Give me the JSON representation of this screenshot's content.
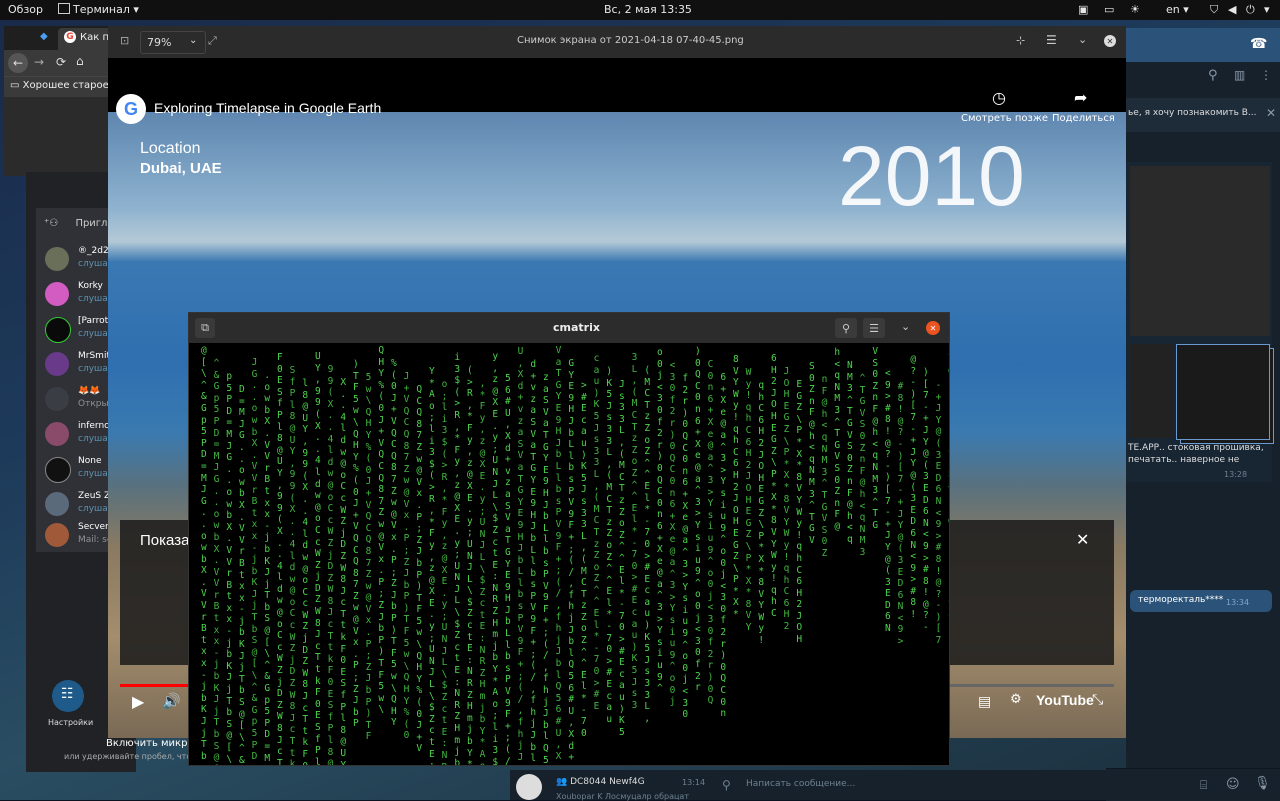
{
  "topbar": {
    "activities": "Обзор",
    "app_menu": "Терминал",
    "datetime": "Вс, 2 мая  13:35",
    "lang": "en"
  },
  "browser": {
    "tab_title": "Как п",
    "bookmark": "Хорошее старое)))"
  },
  "viewer": {
    "zoom": "79%",
    "title": "Снимок экрана от 2021-04-18 07-40-45.png"
  },
  "video": {
    "title": "Exploring Timelapse in Google Earth",
    "watch_later": "Смотреть позже",
    "share": "Поделиться",
    "location_label": "Location",
    "location_value": "Dubai, UAE",
    "year": "2010",
    "overlay_text": "Показа",
    "youtube": "YouTube"
  },
  "terminal": {
    "title": "cmatrix",
    "columns": [
      "     @  [  \\  ^  &  G  p          5  P  D  =  M  J  G  .  .  o  w  b  X  .  V  V  r  B  t  x  x  -  j  b  K  J  j  T  b  S",
      "     F  0  E  S  f  P  l  8  @  U  Y  ,  9  9  (  X  .  .  4  l  d  w  @  o  C  c  W  Z  j  D  Z  W  8  J  c  T  t  k",
      "     )  T  F  5  w  \\  Q  H  Y  %  (  0  J  +  V  Q  C  Q  8  7  Z  w  @  V  x  .  P  ;  Z  J  b  P",
      "     Y  *  A  o  ;  l  i  3  $  (  >  R  ,  *  F  y  ,  z  @  X  E  .  y  ;  U  N  J  L  \\  $  Z  c  t  E  :  N  R  Z  H  m  j  b",
      "     5  6  #  U  ,  X  d  +  v  z  a  S  V  a  T  G  Y  E  9  H  J  b  L  l  b  s  P  V  9  F  +  ;  (  /  ,  f  h  j  J  b  l  Q",
      "     >  #  E  c  a  u  )  K  5  J  s  3  3  L  ,  (  M  C  T  z  Z  o  Z  ^  ^  E  l  *  -  7  0",
      "     o  0  j  <  3  0  f  2  r  )  0  Q  C  0  n  6  +  X  e  @  a  ^  3  >  Y  s  i  u  9  ^",
      "     8  V  Y  W  y  !  q  h  C  6  H  2  J  O  H  E  G  Z  \\  P  *  X  *",
      "     S  0  Z  n  F  @  h  <  q  N  M  3  ^  T  G  V",
      "     <  9  >  #  8  !  @  ?  -  )  [  7  -  +  J  Y  @  (  3  E  D  6  N"
    ]
  },
  "discord": {
    "invite_label": "Пригла",
    "users": [
      {
        "name": "®_2d2",
        "status": "слушае"
      },
      {
        "name": "Korky",
        "status": "слушае"
      },
      {
        "name": "[Parrot",
        "status": "слушае"
      },
      {
        "name": "MrSmit",
        "status": "слушае"
      },
      {
        "name": "🦊🦊",
        "status": "Открыт"
      },
      {
        "name": "inferno",
        "status": "слушае"
      },
      {
        "name": "None",
        "status": "слушае"
      },
      {
        "name": "ZeuS Z",
        "status": "слушае"
      },
      {
        "name": "Secven",
        "status": "Mail: se"
      }
    ],
    "settings_label": "Настройки",
    "mic_text": "Включить микроф",
    "mic_hint": "или удерживайте пробел, что"
  },
  "telegram": {
    "preview_text": "ье, я хочу познакомить В...",
    "message_text": "ТЕ.АРР.. стоковая прошивка, печатать.. наверное не",
    "message_time": "13:28",
    "sent_text": "терморекталь****",
    "sent_time": "13:34",
    "chat_name": "DC8044 Newf4G",
    "chat_time": "13:14",
    "chat_preview": "Xoubopar K Лосмуцалр обрацат",
    "input_placeholder": "Написать сообщение..."
  },
  "colors": {
    "matrix_green": "#4dd54d",
    "telegram_bg": "#17212b",
    "discord_bg": "#202225"
  }
}
